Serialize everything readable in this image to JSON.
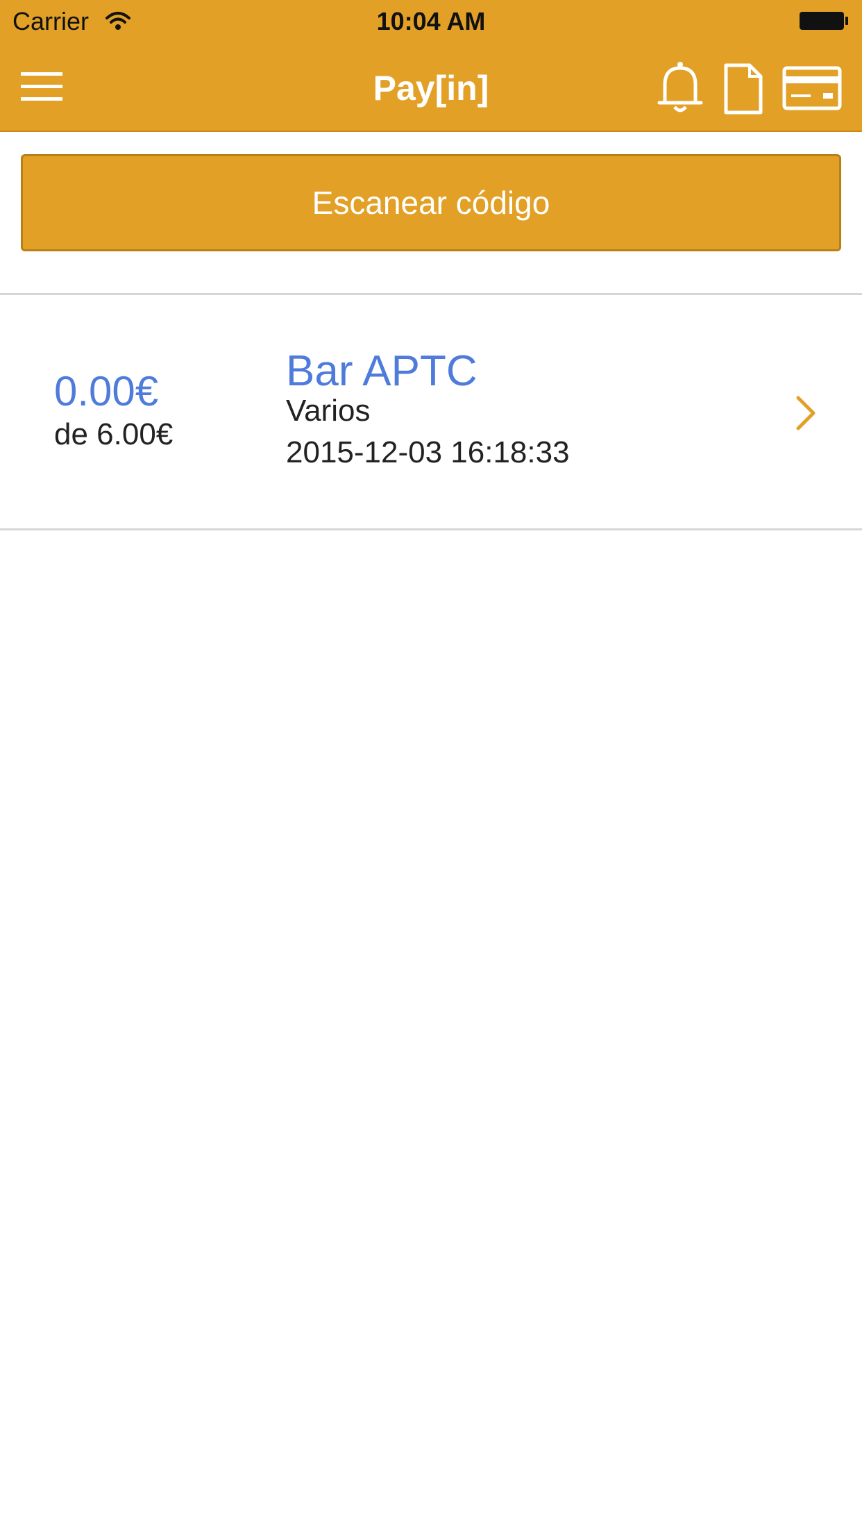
{
  "status_bar": {
    "carrier": "Carrier",
    "time": "10:04 AM",
    "icons": [
      "wifi-icon",
      "battery-icon"
    ]
  },
  "nav": {
    "title": "Pay[in]",
    "icons": [
      "menu-icon",
      "bell-icon",
      "document-icon",
      "credit-card-icon"
    ]
  },
  "scan_button": {
    "label": "Escanear código"
  },
  "orders": [
    {
      "amount_paid": "0.00€",
      "amount_total": "de 6.00€",
      "merchant": "Bar APTC",
      "category": "Varios",
      "datetime": "2015-12-03 16:18:33"
    }
  ],
  "colors": {
    "accent": "#E2A026",
    "link_blue": "#4F7BDB",
    "divider": "#D6D6D6"
  }
}
